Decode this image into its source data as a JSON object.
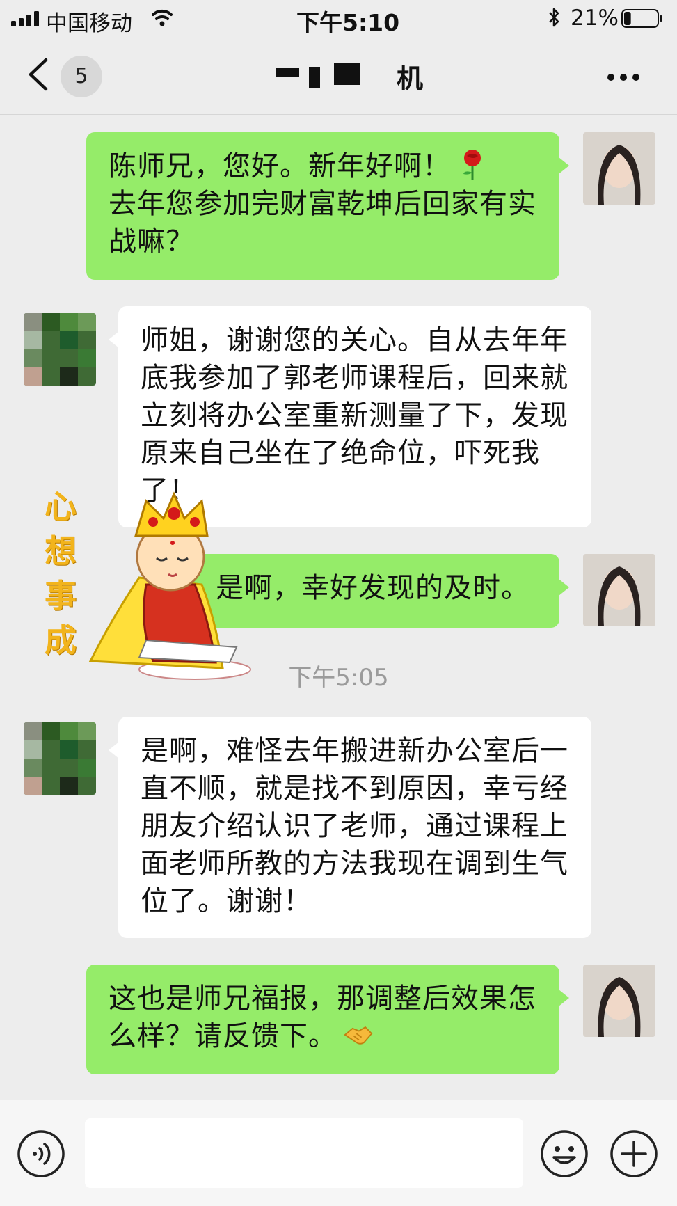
{
  "status_bar": {
    "carrier": "中国移动",
    "time": "下午5:10",
    "battery_percent": "21%",
    "battery_level": 0.21
  },
  "nav": {
    "unread_count": "5",
    "title_visible": "机"
  },
  "messages": [
    {
      "side": "sent",
      "text": "陈师兄，您好。新年好啊！",
      "text2": "去年您参加完财富乾坤后回家有实战嘛？",
      "emoji": "rose"
    },
    {
      "side": "recv",
      "text": "师姐，谢谢您的关心。自从去年年底我参加了郭老师课程后，回来就立刻将办公室重新测量了下，发现原来自己坐在了绝命位，吓死我了！"
    },
    {
      "side": "sent",
      "text": "是啊，幸好发现的及时。"
    },
    {
      "side": "recv",
      "text": "是啊，难怪去年搬进新办公室后一直不顺，就是找不到原因，幸亏经朋友介绍认识了老师，通过课程上面老师所教的方法我现在调到生气位了。谢谢！"
    },
    {
      "side": "sent",
      "text": "这也是师兄福报，那调整后效果怎么样？请反馈下。",
      "emoji": "handshake"
    }
  ],
  "timestamp": "下午5:05",
  "sticker": {
    "caption": "心想事成",
    "icon": "monk-sticker"
  },
  "input_bar": {
    "placeholder": "",
    "icons": [
      "voice-icon",
      "emoji-face-icon",
      "plus-icon"
    ]
  },
  "colors": {
    "sent_bubble": "#95ec69",
    "recv_bubble": "#ffffff",
    "background": "#ededed",
    "timestamp": "#9b9b9b"
  }
}
